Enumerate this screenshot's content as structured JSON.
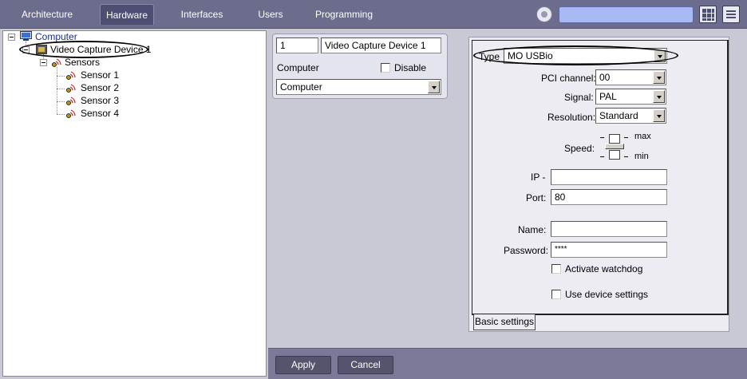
{
  "nav": {
    "tabs": [
      {
        "label": "Architecture"
      },
      {
        "label": "Hardware"
      },
      {
        "label": "Interfaces"
      },
      {
        "label": "Users"
      },
      {
        "label": "Programming"
      }
    ],
    "active_tab": "Hardware",
    "search_value": ""
  },
  "tree": {
    "root": "Computer",
    "device": "Video Capture Device 1",
    "sensors_group": "Sensors",
    "sensors": [
      "Sensor 1",
      "Sensor 2",
      "Sensor 3",
      "Sensor 4"
    ]
  },
  "device_card": {
    "id_value": "1",
    "name_value": "Video Capture Device 1",
    "computer_label": "Computer",
    "disable_label": "Disable",
    "disable_checked": false,
    "computer_select": "Computer"
  },
  "settings": {
    "type_label": "Type",
    "type_value": "MO USBio",
    "pci_label": "PCI channel:",
    "pci_value": "00",
    "signal_label": "Signal:",
    "signal_value": "PAL",
    "resolution_label": "Resolution:",
    "resolution_value": "Standard",
    "speed_label": "Speed:",
    "speed_max": "max",
    "speed_min": "min",
    "ip_label": "IP -",
    "ip_value": "",
    "port_label": "Port:",
    "port_value": "80",
    "name_label": "Name:",
    "name_value": "",
    "password_label": "Password:",
    "password_value": "****",
    "watchdog_label": "Activate watchdog",
    "watchdog_checked": false,
    "use_device_label": "Use device settings",
    "use_device_checked": false,
    "tab_label": "Basic settings"
  },
  "actions": {
    "apply_label": "Apply",
    "cancel_label": "Cancel"
  },
  "colors": {
    "topbar": "#6c6c8c",
    "search_fill": "#a9b9f3",
    "workspace": "#c9c9d6"
  }
}
